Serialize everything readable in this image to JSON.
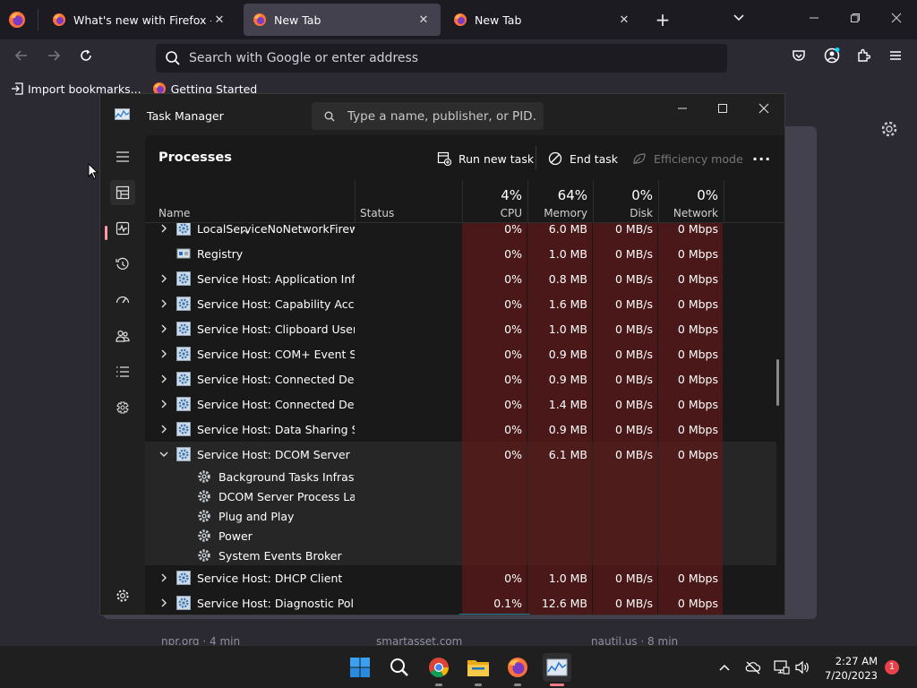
{
  "browser": {
    "tabs": [
      {
        "label": "What's new with Firefox - More",
        "active": false
      },
      {
        "label": "New Tab",
        "active": true
      },
      {
        "label": "New Tab",
        "active": false
      }
    ],
    "new_tab_symbol": "+",
    "list_tabs_symbol": "⌄",
    "url_placeholder": "Search with Google or enter address",
    "bookmarks": [
      {
        "label": "Import bookmarks...",
        "icon": "import-icon"
      },
      {
        "label": "Getting Started",
        "icon": "firefox-icon"
      }
    ],
    "accent": "#ff9400",
    "newtab_cards": [
      "npr.org · 4 min",
      "smartasset.com",
      "nautil.us · 8 min"
    ]
  },
  "task_manager": {
    "title": "Task Manager",
    "search_placeholder": "Type a name, publisher, or PID...",
    "page_title": "Processes",
    "commands": {
      "run_new_task": "Run new task",
      "end_task": "End task",
      "efficiency_mode": "Efficiency mode",
      "more": "···"
    },
    "columns": {
      "name": "Name",
      "status": "Status",
      "cpu": {
        "pct": "4%",
        "label": "CPU"
      },
      "memory": {
        "pct": "64%",
        "label": "Memory"
      },
      "disk": {
        "pct": "0%",
        "label": "Disk"
      },
      "network": {
        "pct": "0%",
        "label": "Network"
      }
    },
    "rows": [
      {
        "name": "LocalServiceNoNetworkFirewa...",
        "cpu": "0%",
        "memory": "6.0 MB",
        "disk": "0 MB/s",
        "network": "0 Mbps",
        "expandable": true,
        "icon": "service-host-icon"
      },
      {
        "name": "Registry",
        "cpu": "0%",
        "memory": "1.0 MB",
        "disk": "0 MB/s",
        "network": "0 Mbps",
        "expandable": false,
        "icon": "registry-icon"
      },
      {
        "name": "Service Host: Application Infor...",
        "cpu": "0%",
        "memory": "0.8 MB",
        "disk": "0 MB/s",
        "network": "0 Mbps",
        "expandable": true,
        "icon": "service-host-icon"
      },
      {
        "name": "Service Host: Capability Acces...",
        "cpu": "0%",
        "memory": "1.6 MB",
        "disk": "0 MB/s",
        "network": "0 Mbps",
        "expandable": true,
        "icon": "service-host-icon"
      },
      {
        "name": "Service Host: Clipboard User S...",
        "cpu": "0%",
        "memory": "1.0 MB",
        "disk": "0 MB/s",
        "network": "0 Mbps",
        "expandable": true,
        "icon": "service-host-icon"
      },
      {
        "name": "Service Host: COM+ Event Sys...",
        "cpu": "0%",
        "memory": "0.9 MB",
        "disk": "0 MB/s",
        "network": "0 Mbps",
        "expandable": true,
        "icon": "service-host-icon"
      },
      {
        "name": "Service Host: Connected Devi...",
        "cpu": "0%",
        "memory": "0.9 MB",
        "disk": "0 MB/s",
        "network": "0 Mbps",
        "expandable": true,
        "icon": "service-host-icon"
      },
      {
        "name": "Service Host: Connected Devi...",
        "cpu": "0%",
        "memory": "1.4 MB",
        "disk": "0 MB/s",
        "network": "0 Mbps",
        "expandable": true,
        "icon": "service-host-icon"
      },
      {
        "name": "Service Host: Data Sharing Ser...",
        "cpu": "0%",
        "memory": "0.9 MB",
        "disk": "0 MB/s",
        "network": "0 Mbps",
        "expandable": true,
        "icon": "service-host-icon"
      },
      {
        "name": "Service Host: DCOM Server Pr...",
        "cpu": "0%",
        "memory": "6.1 MB",
        "disk": "0 MB/s",
        "network": "0 Mbps",
        "expandable": true,
        "expanded": true,
        "icon": "service-host-icon"
      },
      {
        "name": "Background Tasks Infrastr...",
        "child": true,
        "icon": "service-gear-icon"
      },
      {
        "name": "DCOM Server Process Lau...",
        "child": true,
        "icon": "service-gear-icon"
      },
      {
        "name": "Plug and Play",
        "child": true,
        "icon": "service-gear-icon"
      },
      {
        "name": "Power",
        "child": true,
        "icon": "service-gear-icon"
      },
      {
        "name": "System Events Broker",
        "child": true,
        "icon": "service-gear-icon"
      },
      {
        "name": "Service Host: DHCP Client",
        "cpu": "0%",
        "memory": "1.0 MB",
        "disk": "0 MB/s",
        "network": "0 Mbps",
        "expandable": true,
        "icon": "service-host-icon"
      },
      {
        "name": "Service Host: Diagnostic Polic...",
        "cpu": "0.1%",
        "memory": "12.6 MB",
        "disk": "0 MB/s",
        "network": "0 Mbps",
        "expandable": true,
        "icon": "service-host-icon"
      }
    ],
    "sidebar": [
      "hamburger-icon",
      "processes-icon",
      "performance-icon",
      "app-history-icon",
      "startup-apps-icon",
      "users-icon",
      "details-icon",
      "services-icon",
      "settings-icon"
    ],
    "heat_color": "#4a1818"
  },
  "taskbar": {
    "apps": [
      "windows-start-icon",
      "search-icon",
      "chrome-icon",
      "file-explorer-icon",
      "firefox-icon",
      "task-manager-icon"
    ],
    "time": "2:27 AM",
    "date": "7/20/2023",
    "notifications": "1"
  }
}
